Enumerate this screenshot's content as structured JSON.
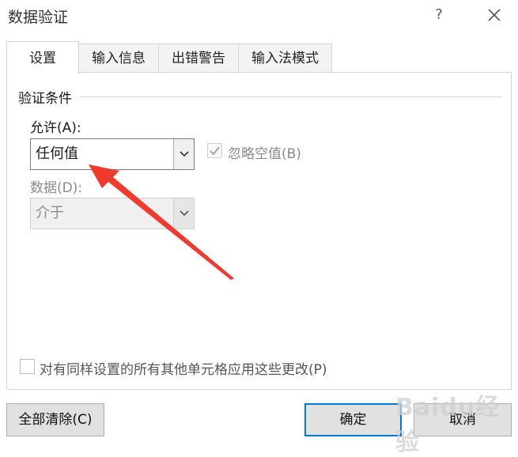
{
  "dialog": {
    "title": "数据验证",
    "help_label": "?"
  },
  "tabs": [
    {
      "label": "设置",
      "active": true
    },
    {
      "label": "输入信息",
      "active": false
    },
    {
      "label": "出错警告",
      "active": false
    },
    {
      "label": "输入法模式",
      "active": false
    }
  ],
  "settings": {
    "group_label": "验证条件",
    "allow_label": "允许(A):",
    "allow_value": "任何值",
    "ignore_blank_label": "忽略空值(B)",
    "ignore_blank_checked": true,
    "data_label": "数据(D):",
    "data_value": "介于",
    "apply_all_label": "对有同样设置的所有其他单元格应用这些更改(P)",
    "apply_all_checked": false
  },
  "buttons": {
    "clear_all": "全部清除(C)",
    "ok": "确定",
    "cancel": "取消"
  },
  "watermark": {
    "text": "Baidu经验"
  },
  "colors": {
    "annotation_arrow": "#f03a2e",
    "focus_border": "#0078d7"
  }
}
